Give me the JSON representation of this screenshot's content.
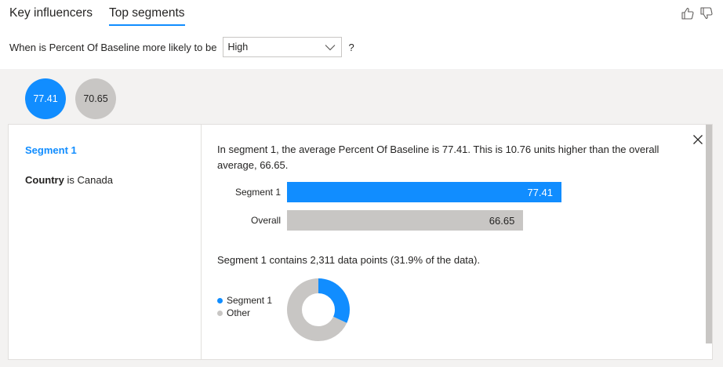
{
  "tabs": [
    {
      "label": "Key influencers",
      "active": false
    },
    {
      "label": "Top segments",
      "active": true
    }
  ],
  "feedback": {
    "like_icon": "thumbs-up-icon",
    "dislike_icon": "thumbs-down-icon"
  },
  "question": {
    "prefix": "When is Percent Of Baseline more likely to be",
    "dropdown_value": "High",
    "suffix": "?"
  },
  "segments": [
    {
      "value": "77.41",
      "selected": true
    },
    {
      "value": "70.65",
      "selected": false
    }
  ],
  "detail": {
    "title": "Segment 1",
    "condition_field": "Country",
    "condition_text": "is Canada",
    "description": "In segment 1, the average Percent Of Baseline is 77.41. This is 10.76 units higher than the overall average, 66.65.",
    "contains_text": "Segment 1 contains 2,311 data points (31.9% of the data).",
    "close_icon": "close-icon"
  },
  "colors": {
    "accent": "#118dff",
    "neutral": "#c8c6c4",
    "band": "#f3f2f1"
  },
  "chart_data": [
    {
      "type": "bar",
      "orientation": "horizontal",
      "categories": [
        "Segment 1",
        "Overall"
      ],
      "values": [
        77.41,
        66.65
      ],
      "value_labels": [
        "77.41",
        "66.65"
      ],
      "colors": [
        "#118dff",
        "#c8c6c4"
      ]
    },
    {
      "type": "pie",
      "style": "donut",
      "labels": [
        "Segment 1",
        "Other"
      ],
      "values": [
        31.9,
        68.1
      ],
      "colors": [
        "#118dff",
        "#c8c6c4"
      ],
      "legend": "left"
    }
  ]
}
